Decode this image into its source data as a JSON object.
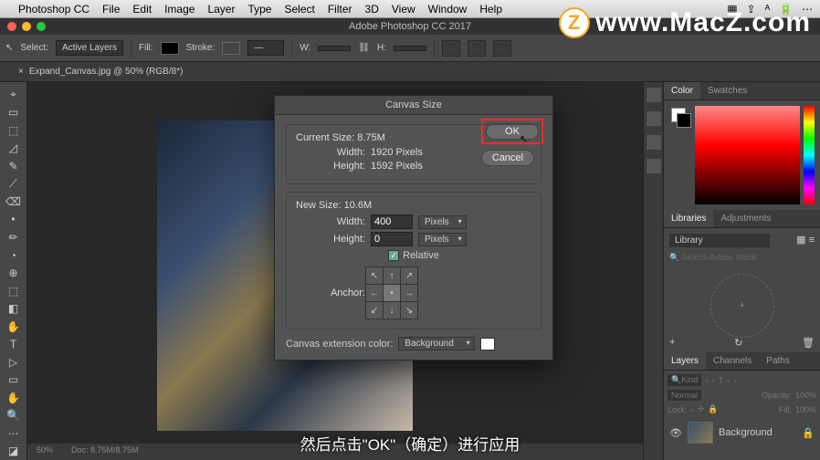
{
  "mac_menu": {
    "apple": "",
    "items": [
      "Photoshop CC",
      "File",
      "Edit",
      "Image",
      "Layer",
      "Type",
      "Select",
      "Filter",
      "3D",
      "View",
      "Window",
      "Help"
    ],
    "right": [
      "▦",
      "⇪",
      "ᴬ",
      "🔋",
      "⋯"
    ]
  },
  "titlebar": "Adobe Photoshop CC 2017",
  "options": {
    "select_label": "Select:",
    "select_value": "Active Layers",
    "fill_label": "Fill:",
    "stroke_label": "Stroke:",
    "w_label": "W:",
    "h_label": "H:"
  },
  "doc_tab": {
    "close": "×",
    "label": "Expand_Canvas.jpg @ 50% (RGB/8*)"
  },
  "tools": [
    "⌖",
    "▭",
    "⬚",
    "◿",
    "✎",
    "⟋",
    "⌫",
    "•",
    "✏",
    "◔",
    "⊕",
    "⬚",
    "◧",
    "✋",
    "T",
    "▷",
    "▭",
    "✋",
    "🔍",
    "⋯",
    "◪"
  ],
  "panels": {
    "color_tabs": [
      "Color",
      "Swatches"
    ],
    "lib_tabs": [
      "Libraries",
      "Adjustments"
    ],
    "library_dd": "Library",
    "search_ph": "Search Adobe Stock",
    "plus": "+",
    "layer_tabs": [
      "Layers",
      "Channels",
      "Paths"
    ],
    "kind": "Kind",
    "blend": "Normal",
    "opacity": "Opacity:",
    "opacity_val": "100%",
    "lock": "Lock:",
    "fill": "Fill:",
    "fill_val": "100%",
    "bg_layer": "Background"
  },
  "dialog": {
    "title": "Canvas Size",
    "current_label": "Current Size: 8.75M",
    "width_label": "Width:",
    "current_width": "1920 Pixels",
    "height_label": "Height:",
    "current_height": "1592 Pixels",
    "new_label": "New Size: 10.6M",
    "new_width": "400",
    "new_height": "0",
    "unit": "Pixels",
    "relative": "Relative",
    "anchor_label": "Anchor:",
    "ext_label": "Canvas extension color:",
    "ext_value": "Background",
    "ok": "OK",
    "cancel": "Cancel",
    "arrows": [
      "↖",
      "↑",
      "↗",
      "←",
      "•",
      "→",
      "↙",
      "↓",
      "↘"
    ]
  },
  "status": {
    "zoom": "50%",
    "doc": "Doc: 8.75M/8.75M"
  },
  "watermark": "www.MacZ.com",
  "subtitle": "然后点击\"OK\"（确定）进行应用"
}
